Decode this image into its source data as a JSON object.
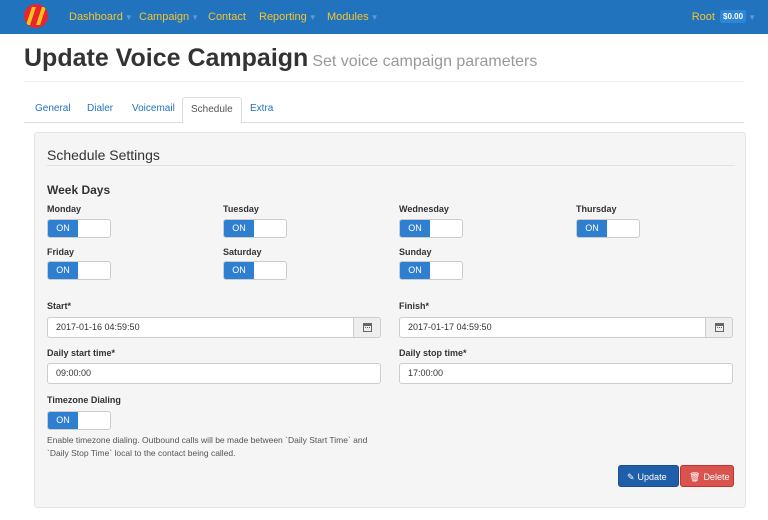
{
  "nav": {
    "items": [
      {
        "label": "Dashboard",
        "caret": true
      },
      {
        "label": "Campaign",
        "caret": true
      },
      {
        "label": "Contact",
        "caret": false
      },
      {
        "label": "Reporting",
        "caret": true
      },
      {
        "label": "Modules",
        "caret": true
      }
    ],
    "user": "Root",
    "balance": "$0.00"
  },
  "header": {
    "title": "Update Voice Campaign",
    "subtitle": "Set voice campaign parameters"
  },
  "tabs": [
    {
      "label": "General",
      "active": false
    },
    {
      "label": "Dialer",
      "active": false
    },
    {
      "label": "Voicemail",
      "active": false
    },
    {
      "label": "Schedule",
      "active": true
    },
    {
      "label": "Extra",
      "active": false
    }
  ],
  "panel": {
    "title": "Schedule Settings",
    "week_days_title": "Week Days",
    "days": [
      {
        "label": "Monday",
        "state": "ON"
      },
      {
        "label": "Tuesday",
        "state": "ON"
      },
      {
        "label": "Wednesday",
        "state": "ON"
      },
      {
        "label": "Thursday",
        "state": "ON"
      },
      {
        "label": "Friday",
        "state": "ON"
      },
      {
        "label": "Saturday",
        "state": "ON"
      },
      {
        "label": "Sunday",
        "state": "ON"
      }
    ],
    "start": {
      "label": "Start*",
      "value": "2017-01-16 04:59:50"
    },
    "finish": {
      "label": "Finish*",
      "value": "2017-01-17 04:59:50"
    },
    "daily_start": {
      "label": "Daily start time*",
      "value": "09:00:00"
    },
    "daily_stop": {
      "label": "Daily stop time*",
      "value": "17:00:00"
    },
    "timezone": {
      "label": "Timezone Dialing",
      "state": "ON",
      "help": "Enable timezone dialing. Outbound calls will be made between `Daily Start Time` and `Daily Stop Time` local to the contact being called."
    },
    "buttons": {
      "update": "Update",
      "delete": "Delete"
    }
  },
  "icons": {
    "logo": "logo-icon",
    "calendar": "calendar-icon",
    "edit": "edit-icon",
    "trash": "trash-icon"
  },
  "colors": {
    "navbar": "#2273bd",
    "nav_text": "#f3c430",
    "toggle_on": "#2e7fd0",
    "update_button": "#1f5ea8",
    "delete_button": "#d9534f"
  }
}
